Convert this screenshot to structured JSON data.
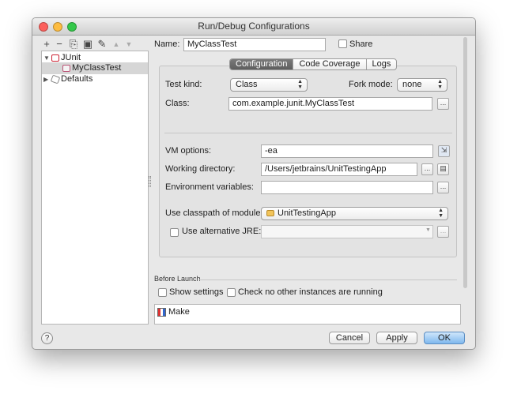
{
  "window": {
    "title": "Run/Debug Configurations"
  },
  "toolbar": {
    "add": "+",
    "remove": "−",
    "copy": "⎘",
    "save": "▣",
    "edit_defaults": "✎",
    "move_up": "▲",
    "move_down": "▼"
  },
  "tree": {
    "items": [
      {
        "label": "JUnit",
        "expanded": true,
        "icon": "junit-icon"
      },
      {
        "label": "MyClassTest",
        "selected": true,
        "icon": "junit-test-icon"
      },
      {
        "label": "Defaults",
        "expanded": false,
        "icon": "defaults-icon"
      }
    ]
  },
  "name": {
    "label": "Name:",
    "value": "MyClassTest"
  },
  "share": {
    "label": "Share",
    "checked": false
  },
  "tabs": [
    {
      "label": "Configuration",
      "active": true
    },
    {
      "label": "Code Coverage",
      "active": false
    },
    {
      "label": "Logs",
      "active": false
    }
  ],
  "config": {
    "test_kind_label": "Test kind:",
    "test_kind_value": "Class",
    "fork_mode_label": "Fork mode:",
    "fork_mode_value": "none",
    "class_label": "Class:",
    "class_value": "com.example.junit.MyClassTest",
    "vm_options_label": "VM options:",
    "vm_options_value": "-ea",
    "working_dir_label": "Working directory:",
    "working_dir_value": "/Users/jetbrains/UnitTestingApp",
    "env_vars_label": "Environment variables:",
    "env_vars_value": "",
    "classpath_label": "Use classpath of module:",
    "classpath_value": "UnitTestingApp",
    "alt_jre_label": "Use alternative JRE:",
    "alt_jre_checked": false,
    "alt_jre_value": "",
    "browse": "..."
  },
  "before_launch": {
    "title": "Before Launch",
    "show_settings": "Show settings",
    "check_instances": "Check no other instances are running",
    "tasks": [
      {
        "label": "Make",
        "icon": "make-icon"
      }
    ]
  },
  "buttons": {
    "help": "?",
    "cancel": "Cancel",
    "apply": "Apply",
    "ok": "OK"
  }
}
